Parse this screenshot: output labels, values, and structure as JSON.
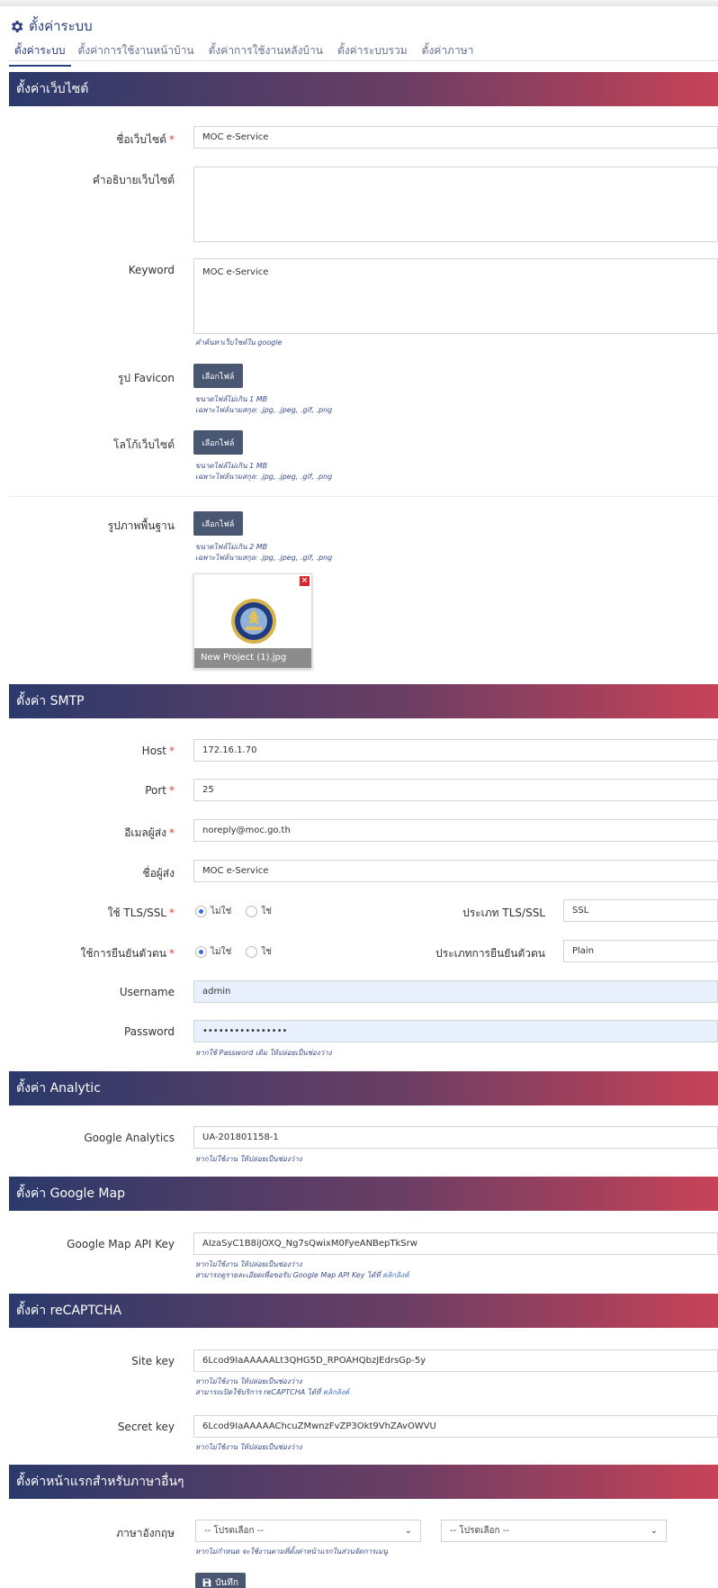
{
  "page": {
    "title": "ตั้งค่าระบบ"
  },
  "tabs": [
    "ตั้งค่าระบบ",
    "ตั้งค่าการใช้งานหน้าบ้าน",
    "ตั้งค่าการใช้งานหลังบ้าน",
    "ตั้งค่าระบบรวม",
    "ตั้งค่าภาษา"
  ],
  "website": {
    "section_title": "ตั้งค่าเว็บไซต์",
    "name_label": "ชื่อเว็บไซต์",
    "name_value": "MOC e-Service",
    "description_label": "คำอธิบายเว็บไซต์",
    "description_value": "",
    "keyword_label": "Keyword",
    "keyword_value": "MOC e-Service",
    "keyword_hint": "คำค้นหาเว็บไซต์ใน google",
    "favicon_label": "รูป Favicon",
    "logo_label": "โลโก้เว็บไซต์",
    "bg_label": "รูปภาพพื้นฐาน",
    "choose_file": "เลือกไฟล์",
    "size_1mb": "ขนาดไฟล์ไม่เกิน 1 MB",
    "size_2mb": "ขนาดไฟล์ไม่เกิน 2 MB",
    "ext_hint": "เฉพาะไฟล์นามสกุล: .jpg, .jpeg, .gif, .png",
    "preview_name": "New Project (1).jpg"
  },
  "smtp": {
    "section_title": "ตั้งค่า SMTP",
    "host_label": "Host",
    "host_value": "172.16.1.70",
    "port_label": "Port",
    "port_value": "25",
    "email_label": "อีเมลผู้ส่ง",
    "email_value": "noreply@moc.go.th",
    "sender_label": "ชื่อผู้ส่ง",
    "sender_value": "MOC e-Service",
    "tls_label": "ใช้ TLS/SSL",
    "tls_type_label": "ประเภท TLS/SSL",
    "tls_type_value": "SSL",
    "auth_label": "ใช้การยืนยันตัวตน",
    "auth_type_label": "ประเภทการยืนยันตัวตน",
    "auth_type_value": "Plain",
    "radio_no": "ไม่ใช่",
    "radio_yes": "ใช่",
    "username_label": "Username",
    "username_value": "admin",
    "password_label": "Password",
    "password_value": "••••••••••••••••",
    "password_hint": "หากใช้ Password เดิม ให้ปล่อยเป็นช่องว่าง"
  },
  "analytic": {
    "section_title": "ตั้งค่า Analytic",
    "label": "Google Analytics",
    "value": "UA-201801158-1",
    "hint": "หากไม่ใช้งาน ให้ปล่อยเป็นช่องว่าง"
  },
  "gmap": {
    "section_title": "ตั้งค่า Google Map",
    "label": "Google Map API Key",
    "value": "AIzaSyC1B8iJOXQ_Ng7sQwixM0FyeANBepTkSrw",
    "hint1": "หากไม่ใช้งาน ให้ปล่อยเป็นช่องว่าง",
    "hint2": "สามารถดูรายละเอียดเพื่อขอรับ Google Map API Key ได้ที่",
    "hint2_link": "คลิกลิงค์"
  },
  "recaptcha": {
    "section_title": "ตั้งค่า reCAPTCHA",
    "site_label": "Site key",
    "site_value": "6Lcod9IaAAAAALt3QHG5D_RPOAHQbzJEdrsGp-5y",
    "site_hint1": "หากไม่ใช้งาน ให้ปล่อยเป็นช่องว่าง",
    "site_hint2": "สามารถเปิดใช้บริการ reCAPTCHA ได้ที่",
    "site_hint2_link": "คลิกลิงค์",
    "secret_label": "Secret key",
    "secret_value": "6Lcod9IaAAAAAChcuZMwnzFvZP3Okt9VhZAvOWVU",
    "secret_hint": "หากไม่ใช้งาน ให้ปล่อยเป็นช่องว่าง"
  },
  "language": {
    "section_title": "ตั้งค่าหน้าแรกสำหรับภาษาอื่นๆ",
    "label": "ภาษาอังกฤษ",
    "select1": "-- โปรดเลือก --",
    "select2": "-- โปรดเลือก --",
    "hint": "หากไม่กำหนด จะใช้งานตามที่ตั้งค่าหน้าแรกในส่วนจัดการเมนู"
  },
  "save_label": "บันทึก",
  "colors": {
    "accent": "#2c3e7e",
    "bar_start": "#2a3a6b",
    "bar_end": "#c84257",
    "button": "#4a5773"
  }
}
